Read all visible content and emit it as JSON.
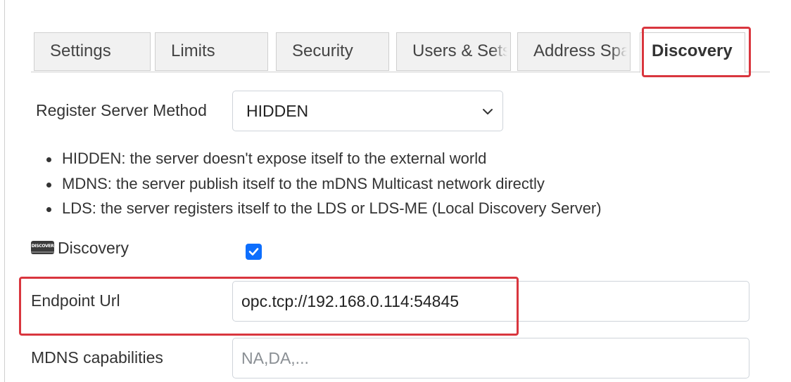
{
  "tabs": [
    {
      "label": "Settings"
    },
    {
      "label": "Limits"
    },
    {
      "label": "Security"
    },
    {
      "label": "Users & Sets"
    },
    {
      "label": "Address Space"
    },
    {
      "label": "Discovery",
      "active": true
    }
  ],
  "register": {
    "label": "Register Server Method",
    "selected": "HIDDEN",
    "options_help": [
      "HIDDEN: the server doesn't expose itself to the external world",
      "MDNS: the server publish itself to the mDNS Multicast network directly",
      "LDS: the server registers itself to the LDS or LDS-ME (Local Discovery Server)"
    ]
  },
  "discovery": {
    "icon_text": "DISCOVER",
    "label": "Discovery",
    "checked": true
  },
  "endpoint": {
    "label": "Endpoint Url",
    "value": "opc.tcp://192.168.0.114:54845"
  },
  "mdns": {
    "label": "MDNS capabilities",
    "placeholder": "NA,DA,..."
  },
  "colors": {
    "highlight": "#d9363e",
    "checkbox": "#0d6efd"
  }
}
